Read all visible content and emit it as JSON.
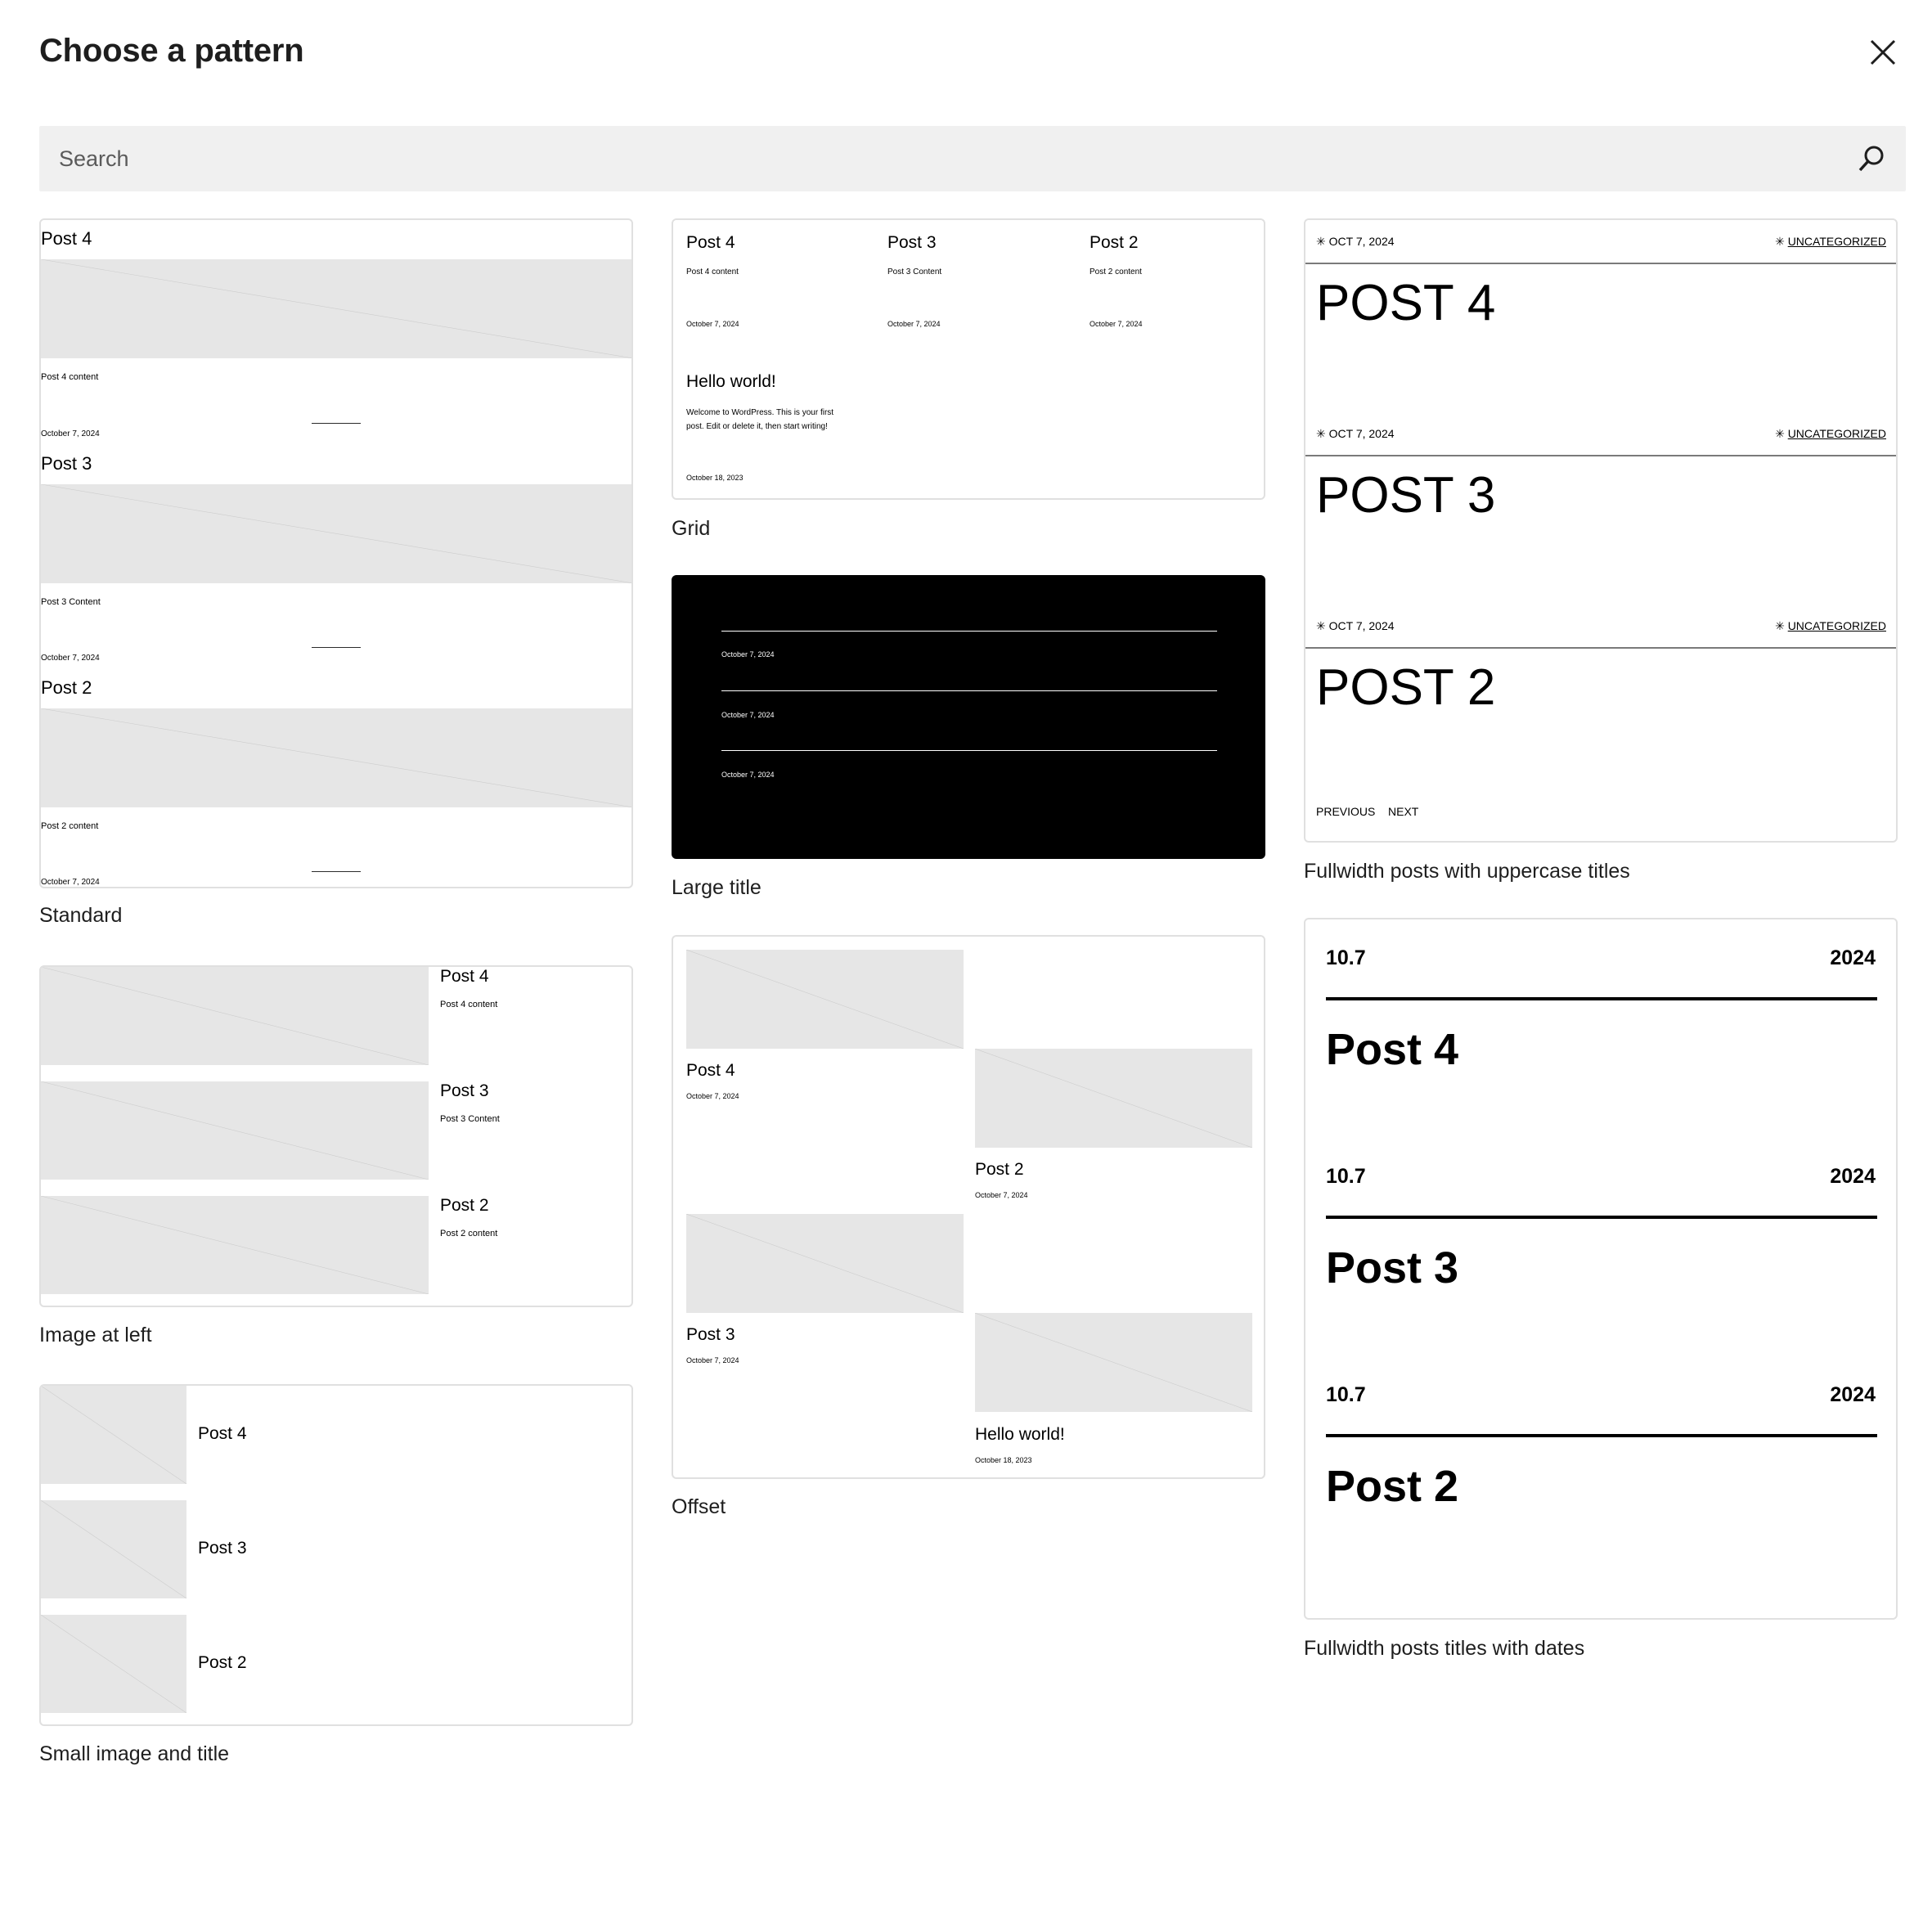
{
  "modal": {
    "title": "Choose a pattern"
  },
  "search": {
    "placeholder": "Search"
  },
  "icons": {
    "close": "close-icon",
    "search": "search-icon"
  },
  "colors": {
    "background": "#ffffff",
    "search_bg": "#f0f0f0",
    "placeholder_fill": "#e6e6e6",
    "card_border": "#e0e0e0",
    "dark_card": "#000000"
  },
  "patterns": {
    "standard": {
      "label": "Standard",
      "posts": [
        {
          "title": "Post 4",
          "content": "Post 4 content",
          "date": "October 7, 2024"
        },
        {
          "title": "Post 3",
          "content": "Post 3 Content",
          "date": "October 7, 2024"
        },
        {
          "title": "Post 2",
          "content": "Post 2 content",
          "date": "October 7, 2024"
        }
      ]
    },
    "grid": {
      "label": "Grid",
      "posts": [
        {
          "title": "Post 4",
          "content": "Post 4 content",
          "date": "October 7, 2024"
        },
        {
          "title": "Post 3",
          "content": "Post 3 Content",
          "date": "October 7, 2024"
        },
        {
          "title": "Post 2",
          "content": "Post 2 content",
          "date": "October 7, 2024"
        },
        {
          "title": "Hello world!",
          "content_line1": "Welcome to WordPress. This is your first",
          "content_line2": "post. Edit or delete it, then start writing!",
          "date": "October 18, 2023"
        }
      ]
    },
    "large_title": {
      "label": "Large title",
      "dates": [
        "October 7, 2024",
        "October 7, 2024",
        "October 7, 2024"
      ]
    },
    "fullwidth_uppercase": {
      "label": "Fullwidth posts with uppercase titles",
      "posts": [
        {
          "date": "OCT 7, 2024",
          "category": "UNCATEGORIZED",
          "title": "POST 4"
        },
        {
          "date": "OCT 7, 2024",
          "category": "UNCATEGORIZED",
          "title": "POST 3"
        },
        {
          "date": "OCT 7, 2024",
          "category": "UNCATEGORIZED",
          "title": "POST 2"
        }
      ],
      "previous": "PREVIOUS",
      "next": "NEXT"
    },
    "image_left": {
      "label": "Image at left",
      "posts": [
        {
          "title": "Post 4",
          "content": "Post 4 content"
        },
        {
          "title": "Post 3",
          "content": "Post 3 Content"
        },
        {
          "title": "Post 2",
          "content": "Post 2 content"
        }
      ]
    },
    "offset": {
      "label": "Offset",
      "posts": [
        {
          "title": "Post 4",
          "date": "October 7, 2024"
        },
        {
          "title": "Post 2",
          "date": "October 7, 2024"
        },
        {
          "title": "Post 3",
          "date": "October 7, 2024"
        },
        {
          "title": "Hello world!",
          "date": "October 18, 2023"
        }
      ]
    },
    "fullwidth_dates": {
      "label": "Fullwidth posts titles with dates",
      "posts": [
        {
          "day": "10.7",
          "year": "2024",
          "title": "Post 4"
        },
        {
          "day": "10.7",
          "year": "2024",
          "title": "Post 3"
        },
        {
          "day": "10.7",
          "year": "2024",
          "title": "Post 2"
        }
      ]
    },
    "small_image": {
      "label": "Small image and title",
      "posts": [
        {
          "title": "Post 4"
        },
        {
          "title": "Post 3"
        },
        {
          "title": "Post 2"
        }
      ]
    }
  }
}
